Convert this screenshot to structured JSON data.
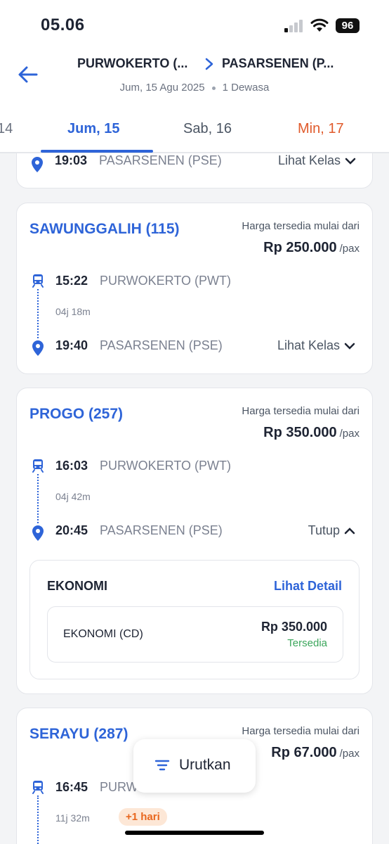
{
  "status_bar": {
    "time": "05.06",
    "battery": "96"
  },
  "header": {
    "origin": "PURWOKERTO (...",
    "destination": "PASARSENEN (P...",
    "date": "Jum, 15 Agu 2025",
    "passengers": "1 Dewasa"
  },
  "date_tabs": [
    {
      "label": "14"
    },
    {
      "label": "Jum, 15"
    },
    {
      "label": "Sab, 16"
    },
    {
      "label": "Min, 17"
    }
  ],
  "colors": {
    "accent": "#2e64d8",
    "weekend": "#e05a2b",
    "available": "#3ba65b"
  },
  "common": {
    "price_from": "Harga tersedia mulai dari",
    "per_pax": "/pax",
    "show_class": "Lihat Kelas",
    "close": "Tutup"
  },
  "partial_card": {
    "arrive_time": "19:03",
    "arrive_station": "PASARSENEN (PSE)"
  },
  "trains": [
    {
      "name": "SAWUNGGALIH (115)",
      "price": "Rp 250.000",
      "depart_time": "15:22",
      "depart_station": "PURWOKERTO (PWT)",
      "duration": "04j 18m",
      "arrive_time": "19:40",
      "arrive_station": "PASARSENEN (PSE)"
    },
    {
      "name": "PROGO (257)",
      "price": "Rp 350.000",
      "depart_time": "16:03",
      "depart_station": "PURWOKERTO (PWT)",
      "duration": "04j 42m",
      "arrive_time": "20:45",
      "arrive_station": "PASARSENEN (PSE)",
      "classes": {
        "title": "EKONOMI",
        "detail_link": "Lihat Detail",
        "item_name": "EKONOMI (CD)",
        "item_price": "Rp 350.000",
        "item_status": "Tersedia"
      }
    },
    {
      "name": "SERAYU (287)",
      "price": "Rp 67.000",
      "depart_time": "16:45",
      "depart_station": "PURW",
      "duration": "11j 32m",
      "day_badge": "+1 hari"
    }
  ],
  "sort_button": {
    "label": "Urutkan"
  }
}
